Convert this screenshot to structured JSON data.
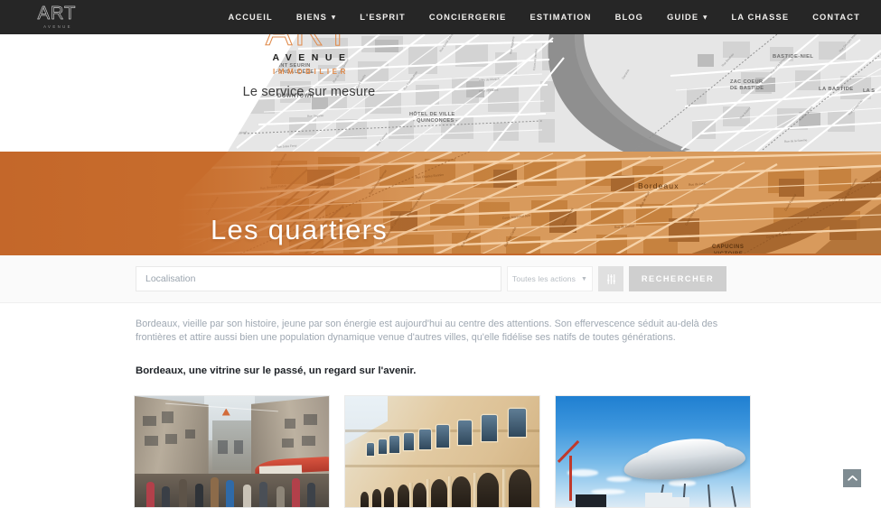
{
  "nav": {
    "logo": {
      "primary": "ART",
      "secondary": "AVENUE"
    },
    "items": [
      {
        "label": "ACCUEIL",
        "has_dropdown": false
      },
      {
        "label": "BIENS",
        "has_dropdown": true
      },
      {
        "label": "L'ESPRIT",
        "has_dropdown": false
      },
      {
        "label": "CONCIERGERIE",
        "has_dropdown": false
      },
      {
        "label": "ESTIMATION",
        "has_dropdown": false
      },
      {
        "label": "BLOG",
        "has_dropdown": false
      },
      {
        "label": "GUIDE",
        "has_dropdown": true
      },
      {
        "label": "LA CHASSE",
        "has_dropdown": false
      },
      {
        "label": "CONTACT",
        "has_dropdown": false
      }
    ]
  },
  "logo": {
    "art": "ART",
    "avenue": "AVENUE",
    "immobilier": "IMMOBILIER",
    "tagline": "Le service sur mesure"
  },
  "hero": {
    "title": "Les quartiers",
    "background": "bordeaux-city-map",
    "map_labels_grey": [
      "SAINT SEURIN - FONDAUDÈGE",
      "DOWNTOWN",
      "HÔTEL DE VILLE - QUINCONCES",
      "BASTIDE-NIEL",
      "ZAC COEUR DE BASTIDE",
      "LA BASTIDE"
    ],
    "map_labels_orange": [
      "Bordeaux",
      "CAPUCINS VICTOIRE"
    ],
    "map_streets": [
      "Rue Fondaudège",
      "Rue Judaïque",
      "Rue Bernard Eabot",
      "Rue de la République",
      "Cours Georges Clemenceau",
      "Rue Charles Bonnier",
      "Rue du Loup",
      "Cours Maréchal Juin",
      "Rue de Cursol",
      "Cours Victor Hugo",
      "Rue de la Benauge",
      "Rue Jules Ferry",
      "Quai de Queyries"
    ]
  },
  "search": {
    "location_placeholder": "Localisation",
    "location_value": "",
    "action_select_label": "Toutes les actions",
    "filter_icon": "tune-sliders-icon",
    "submit_label": "RECHERCHER"
  },
  "content": {
    "intro": "Bordeaux, vieille par son histoire, jeune par son énergie est aujourd'hui au centre des attentions. Son effervescence séduit au-delà des frontières et attire aussi bien une population dynamique venue d'autres villes, qu'elle fidélise ses natifs de toutes générations.",
    "headline": "Bordeaux, une vitrine sur le passé, un regard sur l'avenir.",
    "cards": [
      {
        "alt": "Rue commerçante animée du vieux Bordeaux avec passants et stores rouges"
      },
      {
        "alt": "Façade classique en pierre blonde avec arcades et hautes fenêtres"
      },
      {
        "alt": "Ciel bleu au-dessus d'une sculpture blanche en forme de soucoupe et d'une grue rouge"
      }
    ]
  },
  "scroll_top": {
    "icon": "chevron-up-icon",
    "label": "Haut de page"
  },
  "colors": {
    "nav_background": "#262626",
    "brand_orange": "#e08b4c",
    "band_orange": "#c76c2c",
    "map_grey": "#e4e4e4",
    "search_button": "#cfcfcf",
    "body_text": "#9fa8b2",
    "headline_text": "#1e2227",
    "scroll_top": "#7f8c92"
  }
}
